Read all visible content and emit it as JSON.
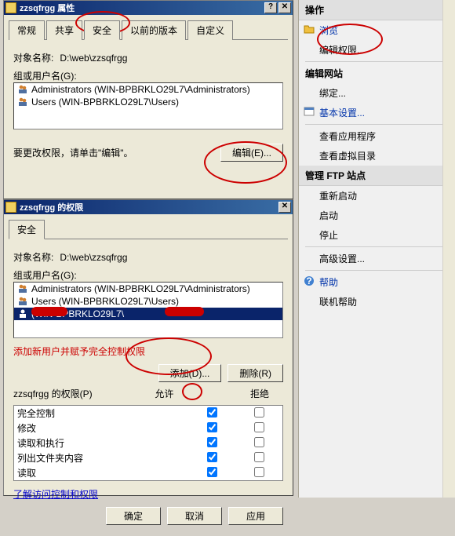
{
  "win1": {
    "title": "zzsqfrgg 属性",
    "tabs": [
      "常规",
      "共享",
      "安全",
      "以前的版本",
      "自定义"
    ],
    "active_tab": 2,
    "object_label": "对象名称:",
    "object_value": "D:\\web\\zzsqfrgg",
    "group_label": "组或用户名(G):",
    "items": [
      "Administrators (WIN-BPBRKLO29L7\\Administrators)",
      "Users (WIN-BPBRKLO29L7\\Users)"
    ],
    "edit_hint": "要更改权限，请单击\"编辑\"。",
    "edit_btn": "编辑(E)..."
  },
  "win2": {
    "title": "zzsqfrgg 的权限",
    "tab": "安全",
    "object_label": "对象名称:",
    "object_value": "D:\\web\\zzsqfrgg",
    "group_label": "组或用户名(G):",
    "items": [
      {
        "text": "Administrators (WIN-BPBRKLO29L7\\Administrators)",
        "sel": false
      },
      {
        "text": "Users (WIN-BPBRKLO29L7\\Users)",
        "sel": false
      },
      {
        "text": "(WIN-BPBRKLO29L7\\",
        "sel": true
      }
    ],
    "add_hint": "添加新用户并赋予完全控制权限",
    "add_btn": "添加(D)...",
    "remove_btn": "删除(R)",
    "perm_header": "zzsqfrgg 的权限(P)",
    "col_allow": "允许",
    "col_deny": "拒绝",
    "rows": [
      {
        "name": "完全控制",
        "allow": true,
        "deny": false
      },
      {
        "name": "修改",
        "allow": true,
        "deny": false
      },
      {
        "name": "读取和执行",
        "allow": true,
        "deny": false
      },
      {
        "name": "列出文件夹内容",
        "allow": true,
        "deny": false
      },
      {
        "name": "读取",
        "allow": true,
        "deny": false
      }
    ],
    "learn_link": "了解访问控制和权限",
    "ok_btn": "确定",
    "cancel_btn": "取消",
    "apply_btn": "应用"
  },
  "panel": {
    "head1": "操作",
    "items1": [
      "浏览",
      "编辑权限...",
      "编辑网站",
      "绑定...",
      "基本设置...",
      "查看应用程序",
      "查看虚拟目录"
    ],
    "head2": "管理 FTP 站点",
    "items2": [
      "重新启动",
      "启动",
      "停止",
      "高级设置..."
    ],
    "items3": [
      "帮助",
      "联机帮助"
    ]
  }
}
